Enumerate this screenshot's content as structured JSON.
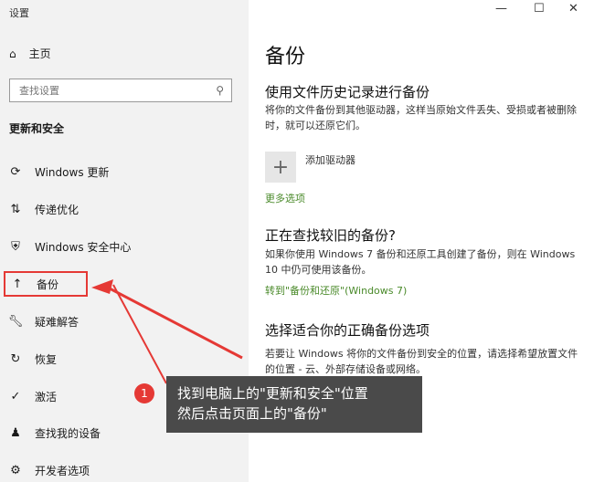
{
  "window": {
    "title": "设置",
    "minimize_glyph": "—",
    "maximize_glyph": "☐",
    "close_glyph": "✕"
  },
  "sidebar": {
    "home_label": "主页",
    "search_placeholder": "查找设置",
    "section_title": "更新和安全",
    "items": [
      {
        "label": "Windows 更新",
        "icon": "sync-icon"
      },
      {
        "label": "传递优化",
        "icon": "delivery-icon"
      },
      {
        "label": "Windows 安全中心",
        "icon": "shield-icon"
      },
      {
        "label": "备份",
        "icon": "arrow-up-icon"
      },
      {
        "label": "疑难解答",
        "icon": "wrench-icon"
      },
      {
        "label": "恢复",
        "icon": "recovery-icon"
      },
      {
        "label": "激活",
        "icon": "check-circle-icon"
      },
      {
        "label": "查找我的设备",
        "icon": "find-device-icon"
      },
      {
        "label": "开发者选项",
        "icon": "developer-icon"
      }
    ]
  },
  "main": {
    "title": "备份",
    "file_history": {
      "heading": "使用文件历史记录进行备份",
      "description": "将你的文件备份到其他驱动器，这样当原始文件丢失、受损或者被删除时，就可以还原它们。",
      "add_drive_label": "添加驱动器",
      "more_options": "更多选项"
    },
    "older_backup": {
      "heading": "正在查找较旧的备份?",
      "description": "如果你使用 Windows 7 备份和还原工具创建了备份，则在 Windows 10 中仍可使用该备份。",
      "link": "转到\"备份和还原\"(Windows 7)"
    },
    "choose": {
      "heading": "选择适合你的正确备份选项",
      "description": "若要让 Windows 将你的文件备份到安全的位置，请选择希望放置文件的位置 - 云、外部存储设备或网络。"
    }
  },
  "annotation": {
    "badge": "1",
    "line1": "找到电脑上的\"更新和安全\"位置",
    "line2": "然后点击页面上的\"备份\"",
    "accent": "#e53935"
  }
}
